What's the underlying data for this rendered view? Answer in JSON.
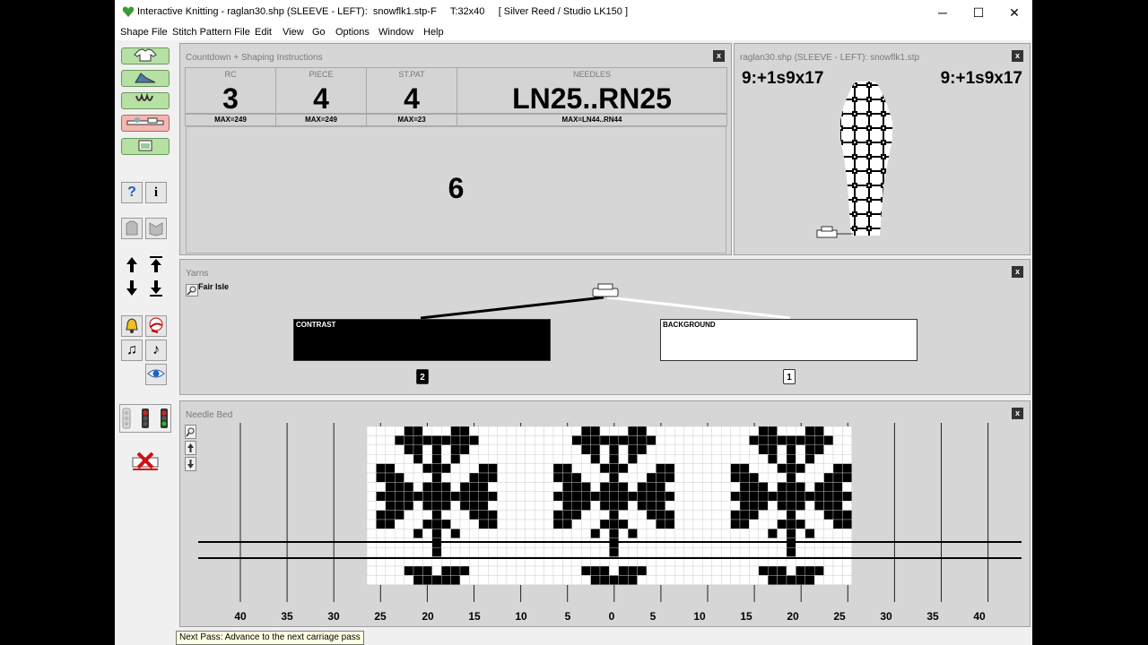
{
  "window": {
    "title": "Interactive Knitting - raglan30.shp (SLEEVE - LEFT):  snowflk1.stp-F     T:32x40     [ Silver Reed / Studio LK150 ]",
    "minimize": "─",
    "maximize": "☐",
    "close": "✕"
  },
  "menu": [
    "Shape File",
    "Stitch Pattern File",
    "Edit",
    "View",
    "Go",
    "Options",
    "Window",
    "Help"
  ],
  "toolbar": {
    "help_label": "?",
    "info_label": "i",
    "music1_label": "♫",
    "music2_label": "♪"
  },
  "countdown": {
    "title": "Countdown + Shaping Instructions",
    "close": "x",
    "cells": [
      {
        "label": "RC",
        "value": "3",
        "max": "MAX=249"
      },
      {
        "label": "PIECE",
        "value": "4",
        "max": "MAX=249"
      },
      {
        "label": "ST.PAT",
        "value": "4",
        "max": "MAX=23"
      },
      {
        "label": "NEEDLES",
        "value": "LN25..RN25",
        "max": "MAX=LN44..RN44"
      }
    ],
    "instruction": "6"
  },
  "preview": {
    "title": "raglan30.shp (SLEEVE - LEFT):  snowflk1.stp",
    "close": "x",
    "left_text": "9:+1s9x17",
    "right_text": "9:+1s9x17"
  },
  "yarns": {
    "title": "Yarns",
    "close": "x",
    "mode": "Fair Isle",
    "contrast_label": "CONTRAST",
    "background_label": "BACKGROUND",
    "contrast_feeder": "2",
    "background_feeder": "1",
    "contrast_color": "#000000",
    "background_color": "#ffffff"
  },
  "needlebed": {
    "title": "Needle Bed",
    "close": "x",
    "axis": [
      "40",
      "35",
      "30",
      "25",
      "20",
      "15",
      "10",
      "5",
      "0",
      "5",
      "10",
      "15",
      "20",
      "25",
      "30",
      "35",
      "40"
    ]
  },
  "status": "Next Pass: Advance to the next carriage pass"
}
